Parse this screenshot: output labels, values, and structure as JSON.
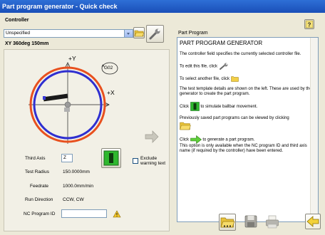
{
  "window": {
    "title": "Part program generator - Quick check"
  },
  "controller": {
    "label": "Controller",
    "selected": "Unspecified"
  },
  "test": {
    "header": "XY 360deg 150mm",
    "axis_y": "+Y",
    "axis_x": "+X",
    "g_code": "G02"
  },
  "fields": {
    "third_axis_label": "Third Axis",
    "third_axis_value": "Z",
    "test_radius_label": "Test Radius",
    "test_radius_value": "150.0000mm",
    "feedrate_label": "Feedrate",
    "feedrate_value": "1000.0mm/min",
    "run_direction_label": "Run Direction",
    "run_direction_value": "CCW, CW",
    "nc_program_label": "NC Program ID",
    "nc_program_value": ""
  },
  "exclude_warning": {
    "label_line1": "Exclude",
    "label_line2": "warning text",
    "checked": false
  },
  "part_program": {
    "label": "Part Program",
    "heading": "PART PROGRAM GENERATOR",
    "p1": "The controller field specifies the currently selected controller file.",
    "p2": "To edit this file, click",
    "p3": "To select another file, click",
    "p4": "The test template details are shown on the left. These are used by the generator to create the part program.",
    "p5a": "Click",
    "p5b": "to simulate ballbar movement.",
    "p6": "Previously saved part programs can be viewed by clicking",
    "p7a": "Click",
    "p7b": "to generate a part program.",
    "p7c": "This option is only available when the NC program ID and third axis name (if required by the controller) have been entered."
  },
  "colors": {
    "blue": "#2f2fd0",
    "red": "#e8501e",
    "green": "#2fb82f",
    "accent": "#2e6fd6"
  }
}
